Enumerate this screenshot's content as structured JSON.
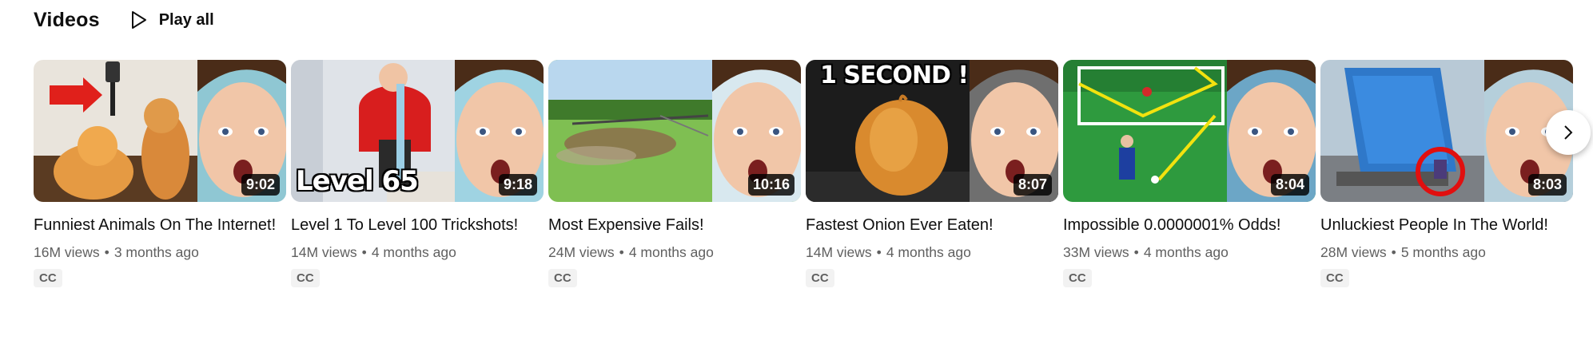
{
  "shelf": {
    "title": "Videos",
    "play_all_label": "Play all",
    "icons": {
      "play": "play-outline-icon",
      "next": "chevron-right-icon"
    }
  },
  "videos": [
    {
      "title": "Funniest Animals On The Internet!",
      "duration": "9:02",
      "views": "16M views",
      "age": "3 months ago",
      "cc": "CC",
      "overlay": ""
    },
    {
      "title": "Level 1 To Level 100 Trickshots!",
      "duration": "9:18",
      "views": "14M views",
      "age": "4 months ago",
      "cc": "CC",
      "overlay": "Level 65"
    },
    {
      "title": "Most Expensive Fails!",
      "duration": "10:16",
      "views": "24M views",
      "age": "4 months ago",
      "cc": "CC",
      "overlay": ""
    },
    {
      "title": "Fastest Onion Ever Eaten!",
      "duration": "8:07",
      "views": "14M views",
      "age": "4 months ago",
      "cc": "CC",
      "overlay": "1 SECOND !"
    },
    {
      "title": "Impossible 0.0000001% Odds!",
      "duration": "8:04",
      "views": "33M views",
      "age": "4 months ago",
      "cc": "CC",
      "overlay": ""
    },
    {
      "title": "Unluckiest People In The World!",
      "duration": "8:03",
      "views": "28M views",
      "age": "5 months ago",
      "cc": "CC",
      "overlay": ""
    }
  ],
  "colors": {
    "text": "#0f0f0f",
    "meta": "#606060",
    "badge_bg": "#f2f2f2"
  }
}
